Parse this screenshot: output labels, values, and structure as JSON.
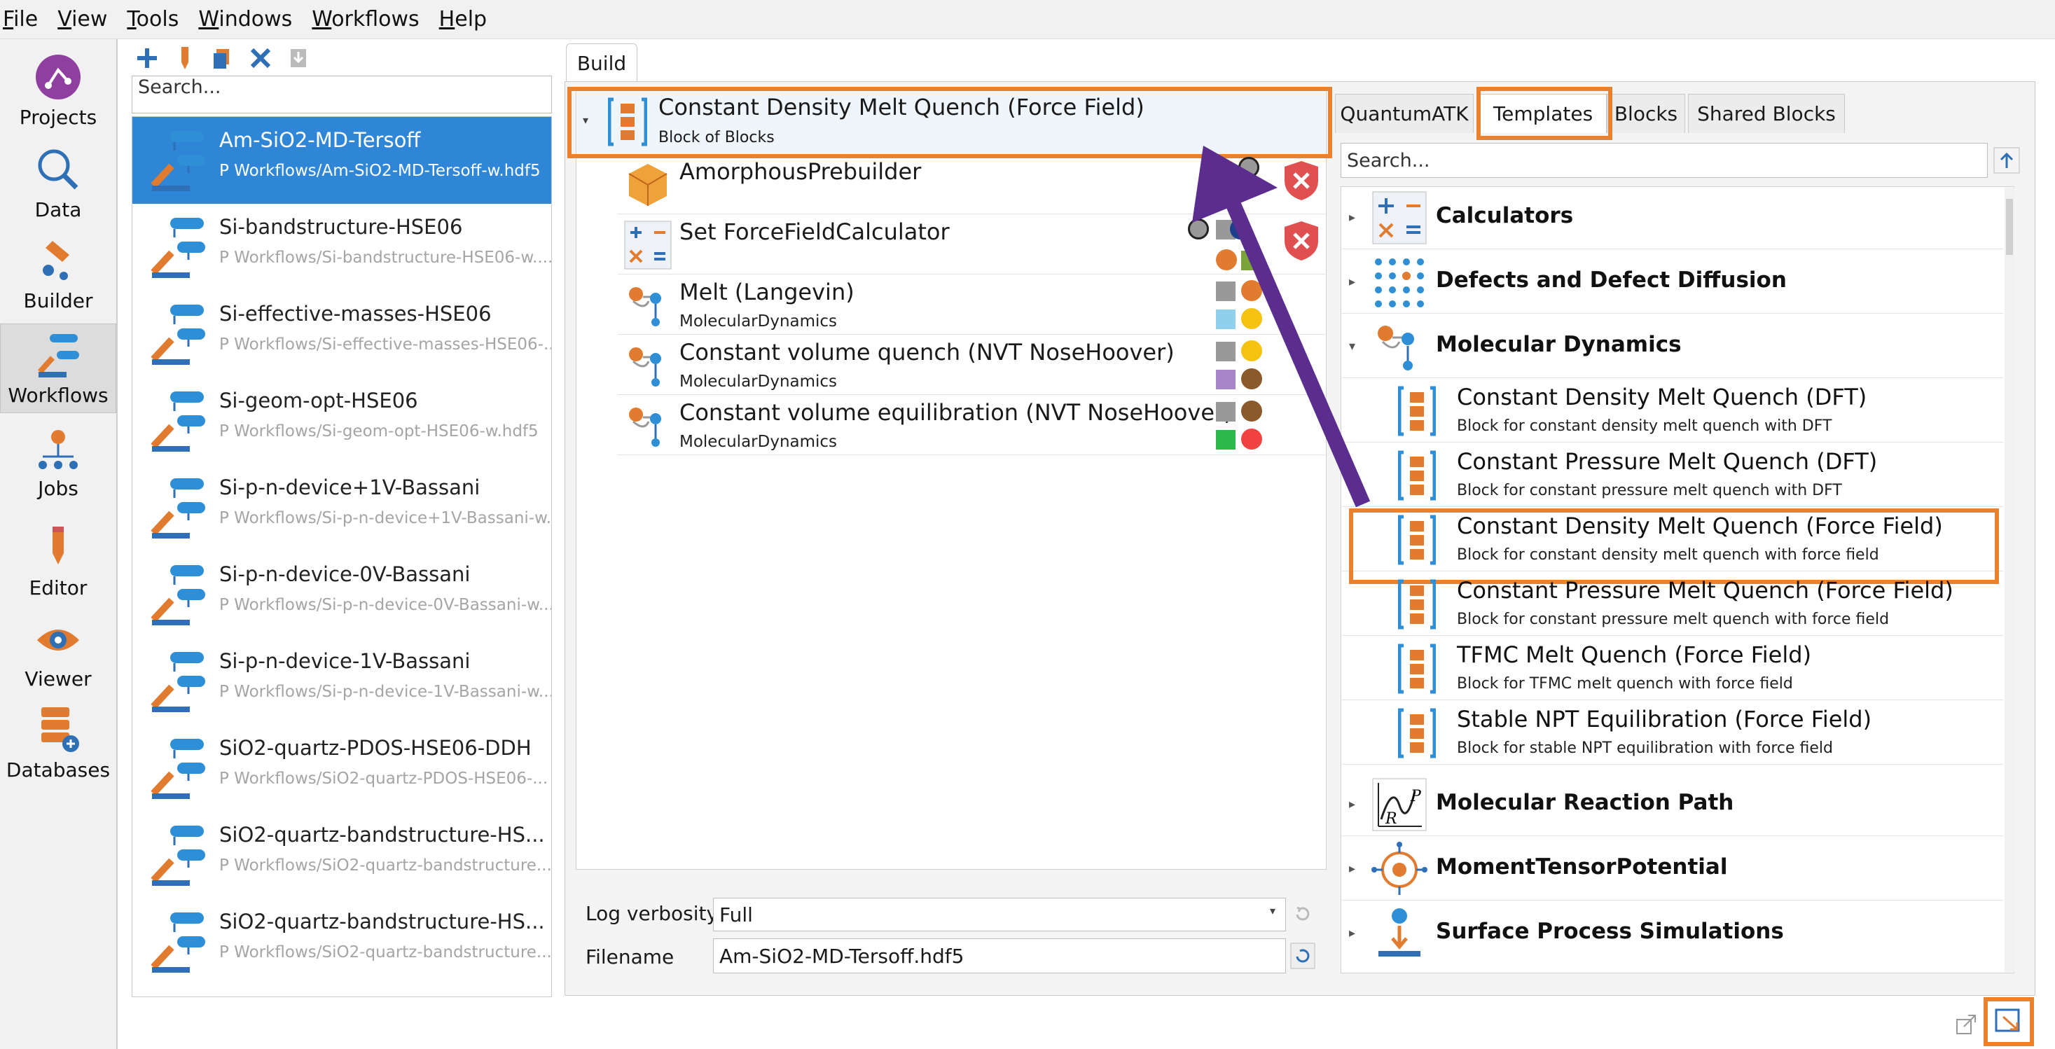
{
  "menu": [
    "File",
    "View",
    "Tools",
    "Windows",
    "Workflows",
    "Help"
  ],
  "nav": [
    "Projects",
    "Data",
    "Builder",
    "Workflows",
    "Jobs",
    "Editor",
    "Viewer",
    "Databases"
  ],
  "workflows": {
    "search_placeholder": "Search...",
    "items": [
      {
        "name": "Am-SiO2-MD-Tersoff",
        "path": "P Workflows/Am-SiO2-MD-Tersoff-w.hdf5"
      },
      {
        "name": "Si-bandstructure-HSE06",
        "path": "P Workflows/Si-bandstructure-HSE06-w...."
      },
      {
        "name": "Si-effective-masses-HSE06",
        "path": "P Workflows/Si-effective-masses-HSE06-..."
      },
      {
        "name": "Si-geom-opt-HSE06",
        "path": "P Workflows/Si-geom-opt-HSE06-w.hdf5"
      },
      {
        "name": "Si-p-n-device+1V-Bassani",
        "path": "P Workflows/Si-p-n-device+1V-Bassani-w..."
      },
      {
        "name": "Si-p-n-device-0V-Bassani",
        "path": "P Workflows/Si-p-n-device-0V-Bassani-w..."
      },
      {
        "name": "Si-p-n-device-1V-Bassani",
        "path": "P Workflows/Si-p-n-device-1V-Bassani-w..."
      },
      {
        "name": "SiO2-quartz-PDOS-HSE06-DDH",
        "path": "P Workflows/SiO2-quartz-PDOS-HSE06-..."
      },
      {
        "name": "SiO2-quartz-bandstructure-HS...",
        "path": "P Workflows/SiO2-quartz-bandstructure..."
      },
      {
        "name": "SiO2-quartz-bandstructure-HS...",
        "path": "P Workflows/SiO2-quartz-bandstructure..."
      }
    ]
  },
  "build": {
    "tab": "Build",
    "root": {
      "title": "Constant Density Melt Quench (Force Field)",
      "subtitle": "Block of Blocks"
    },
    "blocks": [
      {
        "title": "AmorphousPrebuilder",
        "subtitle": ""
      },
      {
        "title": "Set ForceFieldCalculator",
        "subtitle": ""
      },
      {
        "title": "Melt (Langevin)",
        "subtitle": "MolecularDynamics"
      },
      {
        "title": "Constant volume quench (NVT NoseHoover)",
        "subtitle": "MolecularDynamics"
      },
      {
        "title": "Constant volume equilibration (NVT NoseHoover)",
        "subtitle": "MolecularDynamics"
      }
    ],
    "log_label": "Log verbosity",
    "log_value": "Full",
    "filename_label": "Filename",
    "filename_value": "Am-SiO2-MD-Tersoff.hdf5"
  },
  "right_tabs": [
    "QuantumATK",
    "Templates",
    "Blocks",
    "Shared Blocks"
  ],
  "templates": {
    "search_placeholder": "Search...",
    "categories": [
      "Calculators",
      "Defects and Defect Diffusion",
      "Molecular Dynamics",
      "Molecular Reaction Path",
      "MomentTensorPotential",
      "Surface Process Simulations"
    ],
    "md_items": [
      {
        "title": "Constant Density Melt Quench (DFT)",
        "desc": "Block for constant density melt quench with DFT"
      },
      {
        "title": "Constant Pressure Melt Quench (DFT)",
        "desc": "Block for constant pressure melt quench with DFT"
      },
      {
        "title": "Constant Density Melt Quench (Force Field)",
        "desc": "Block for constant density melt quench with force field"
      },
      {
        "title": "Constant Pressure Melt Quench (Force Field)",
        "desc": "Block for constant pressure melt quench with force field"
      },
      {
        "title": "TFMC Melt Quench (Force Field)",
        "desc": "Block for TFMC melt quench with force field"
      },
      {
        "title": "Stable NPT Equilibration (Force Field)",
        "desc": "Block for stable NPT equilibration with force field"
      }
    ]
  },
  "colors": {
    "accent": "#e8822f",
    "arrow": "#5b2d8e",
    "select": "#2f86d6"
  }
}
